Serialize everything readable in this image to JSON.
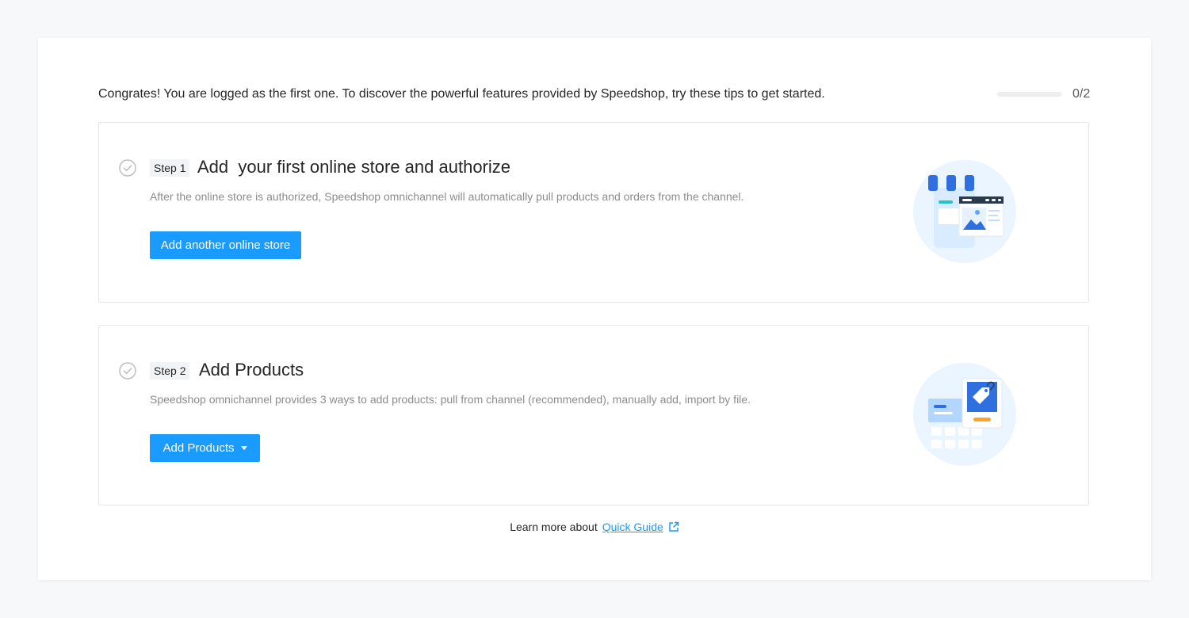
{
  "intro": {
    "text": "Congrates! You are logged as the first one. To discover the powerful features provided by Speedshop, try these tips to get started."
  },
  "progress": {
    "completed": 0,
    "total": 2,
    "label": "0/2"
  },
  "steps": [
    {
      "tag": "Step 1",
      "title": "Add  your first online store and authorize",
      "description": "After the online store is authorized, Speedshop omnichannel will automatically pull products and orders from the channel.",
      "button_label": "Add another online store",
      "icon": "check-circle-icon",
      "illustration": "online-store-illustration"
    },
    {
      "tag": "Step 2",
      "title": "Add Products",
      "description": "Speedshop omnichannel provides 3 ways to add products: pull from channel (recommended), manually add, import by file.",
      "button_label": "Add Products",
      "icon": "check-circle-icon",
      "illustration": "products-illustration"
    }
  ],
  "footer": {
    "text": "Learn more about",
    "link_label": "Quick Guide",
    "icon": "external-link-icon"
  },
  "colors": {
    "primary": "#1a9bff",
    "text": "#262626",
    "muted": "#8c8c8c",
    "border": "#e5e7eb",
    "page_bg": "#f7f8fa"
  }
}
